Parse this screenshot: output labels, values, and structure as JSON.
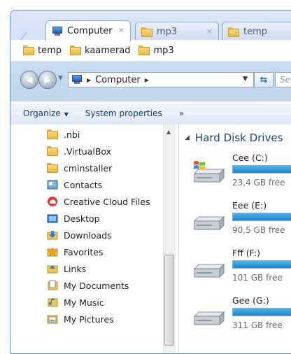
{
  "tabs": [
    {
      "label": "Computer",
      "active": true,
      "icon": "computer-icon"
    },
    {
      "label": "mp3",
      "active": false,
      "icon": "folder-icon"
    },
    {
      "label": "temp",
      "active": false,
      "icon": "folder-icon"
    }
  ],
  "bookmarks": [
    {
      "label": "temp"
    },
    {
      "label": "kaamerad"
    },
    {
      "label": "mp3"
    }
  ],
  "address": {
    "crumb": "Computer",
    "search_placeholder": "Se"
  },
  "commands": {
    "organize": "Organize",
    "system_properties": "System properties",
    "more": "»"
  },
  "nav_items": [
    {
      "label": ".nbi",
      "icon": "folder-icon"
    },
    {
      "label": ".VirtualBox",
      "icon": "folder-icon"
    },
    {
      "label": "cminstaller",
      "icon": "folder-icon"
    },
    {
      "label": "Contacts",
      "icon": "contacts-icon"
    },
    {
      "label": "Creative Cloud Files",
      "icon": "creative-cloud-icon"
    },
    {
      "label": "Desktop",
      "icon": "desktop-icon"
    },
    {
      "label": "Downloads",
      "icon": "downloads-icon"
    },
    {
      "label": "Favorites",
      "icon": "favorites-icon"
    },
    {
      "label": "Links",
      "icon": "links-icon"
    },
    {
      "label": "My Documents",
      "icon": "documents-icon"
    },
    {
      "label": "My Music",
      "icon": "music-icon"
    },
    {
      "label": "My Pictures",
      "icon": "pictures-icon"
    }
  ],
  "content": {
    "section_title": "Hard Disk Drives",
    "drives": [
      {
        "label": "Cee (C:)",
        "free": "23,4 GB free",
        "used_fraction": 0.88,
        "windows_logo": true
      },
      {
        "label": "Eee (E:)",
        "free": "90,5 GB free",
        "used_fraction": 0.85,
        "windows_logo": false
      },
      {
        "label": "Fff (F:)",
        "free": "101 GB free",
        "used_fraction": 0.85,
        "windows_logo": false
      },
      {
        "label": "Gee (G:)",
        "free": "311 GB free",
        "used_fraction": 0.85,
        "windows_logo": false
      }
    ]
  },
  "colors": {
    "accent": "#1e3f8a",
    "progress": "#2a95d6",
    "frame": "#cfe0f3"
  }
}
